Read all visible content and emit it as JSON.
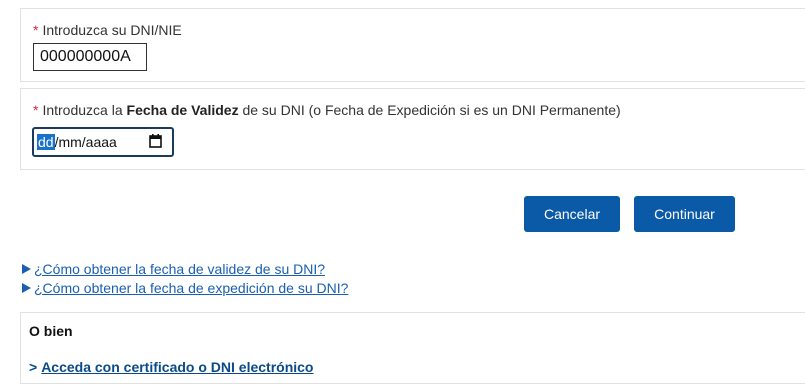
{
  "dni_section": {
    "required_mark": "*",
    "label": "Introduzca su DNI/NIE",
    "value": "000000000A"
  },
  "fecha_section": {
    "required_mark": "*",
    "label_prefix": "Introduzca la ",
    "label_bold": "Fecha de Validez",
    "label_suffix": " de su DNI (o Fecha de Expedición si es un DNI Permanente)",
    "date_day_placeholder": "dd",
    "date_rest_placeholder": "/mm/aaaa",
    "calendar_icon": "calendar-icon"
  },
  "buttons": {
    "cancel": "Cancelar",
    "continue": "Continuar",
    "color": "#0a5aa8"
  },
  "help_links": [
    "¿Cómo obtener la fecha de validez de su DNI?",
    "¿Cómo obtener la fecha de expedición de su DNI?"
  ],
  "alternative": {
    "title": "O bien",
    "link_prefix": ">",
    "link_text": "Acceda con certificado o DNI electrónico"
  }
}
